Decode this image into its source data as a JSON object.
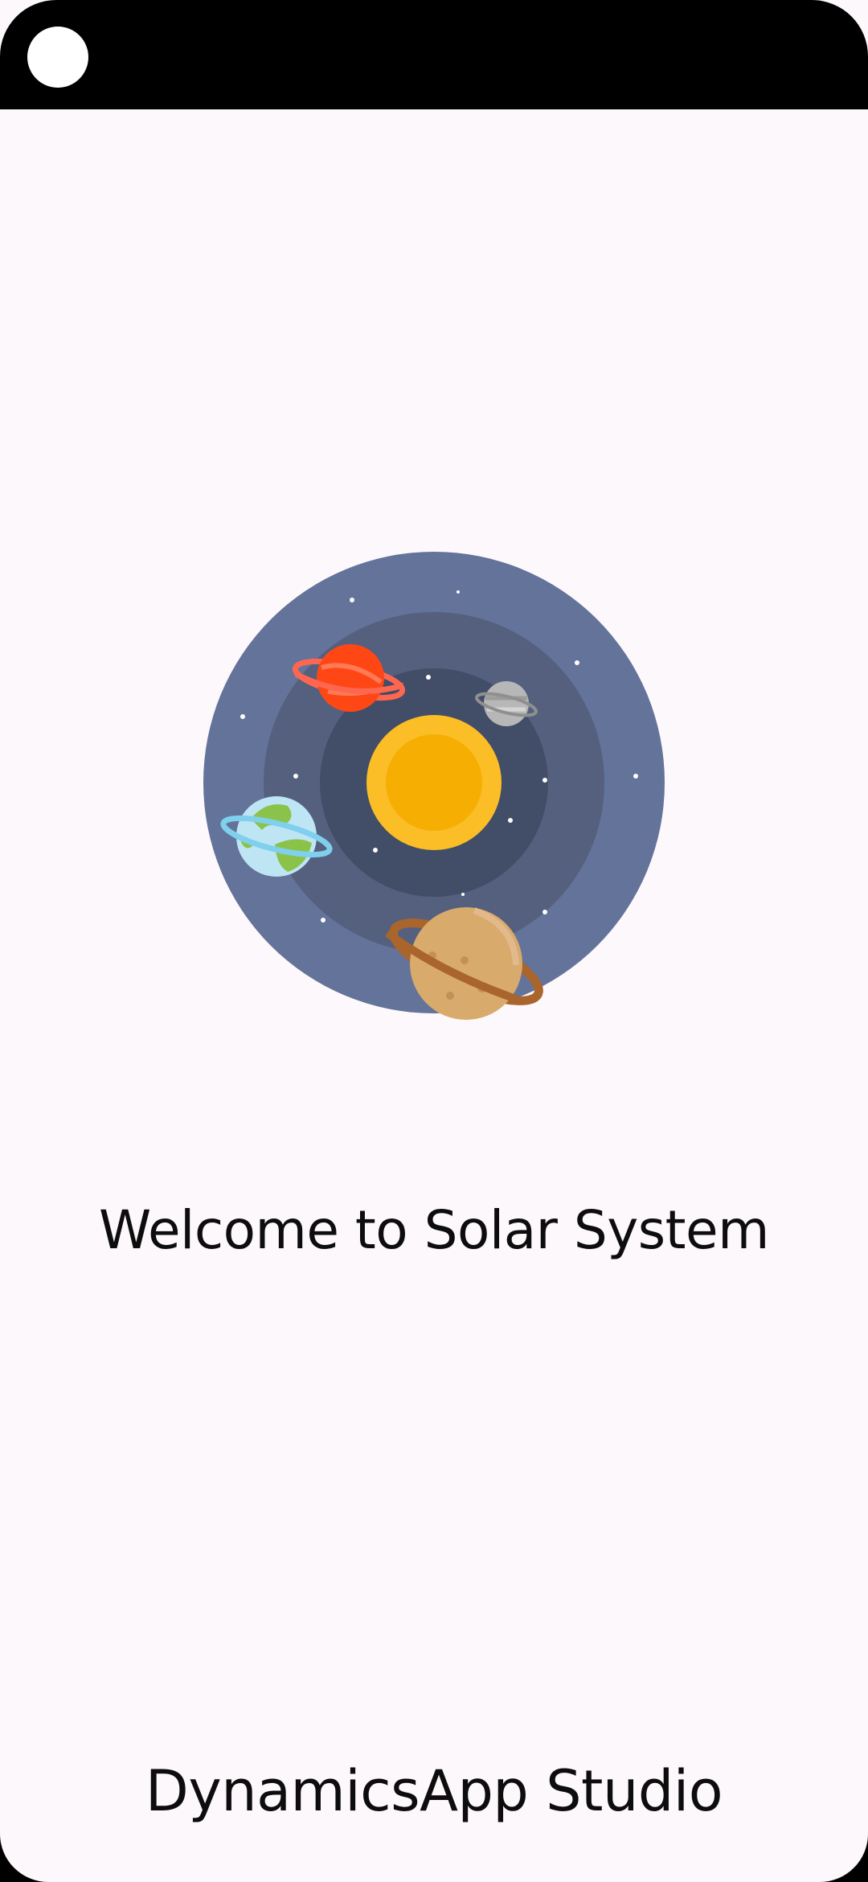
{
  "splash": {
    "title": "Welcome to Solar System",
    "brand": "DynamicsApp Studio"
  },
  "illustration": {
    "name": "solar-system-illustration",
    "colors": {
      "outer_ring": "#64739a",
      "middle_ring": "#54607e",
      "inner_ring": "#424d68",
      "sun_outer": "#fbbe27",
      "sun_inner": "#f6ae03",
      "red_planet": "#ff4716",
      "grey_planet": "#b7b7b7",
      "earth_ocean": "#bde5f3",
      "earth_land": "#8bc34a",
      "saturn_body": "#d8aa6c",
      "saturn_ring": "#a9652b"
    }
  },
  "colors": {
    "background": "#fdf8fb",
    "status_bar": "#000000",
    "text": "#0d0d0d"
  }
}
